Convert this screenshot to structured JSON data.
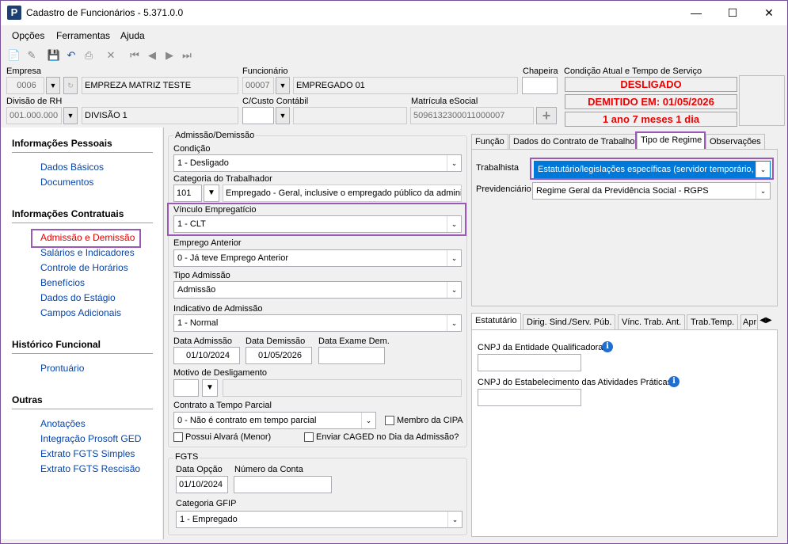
{
  "window": {
    "title": "Cadastro de Funcionários - 5.371.0.0",
    "app_icon": "P"
  },
  "menu": [
    "Opções",
    "Ferramentas",
    "Ajuda"
  ],
  "header": {
    "empresa_label": "Empresa",
    "empresa_code": "0006",
    "empresa_name": "EMPREZA MATRIZ TESTE",
    "funcionario_label": "Funcionário",
    "funcionario_code": "00007",
    "funcionario_name": "EMPREGADO 01",
    "chapeira_label": "Chapeira",
    "chapeira_value": "",
    "divisao_label": "Divisão de RH",
    "divisao_code": "001.000.000",
    "divisao_name": "DIVISÃO 1",
    "ccusto_label": "C/Custo Contábil",
    "matricula_label": "Matrícula eSocial",
    "matricula_value": "5096132300011000007",
    "status_label": "Condição Atual e Tempo de Serviço",
    "status_1": "DESLIGADO",
    "status_2": "DEMITIDO EM: 01/05/2026",
    "status_3": "1 ano 7 meses 1 dia"
  },
  "sidebar": {
    "sections": [
      {
        "title": "Informações Pessoais",
        "items": [
          "Dados Básicos",
          "Documentos"
        ]
      },
      {
        "title": "Informações Contratuais",
        "items": [
          "Admissão e Demissão",
          "Salários e Indicadores",
          "Controle de Horários",
          "Benefícios",
          "Dados do Estágio",
          "Campos Adicionais"
        ]
      },
      {
        "title": "Histórico Funcional",
        "items": [
          "Prontuário"
        ]
      },
      {
        "title": "Outras",
        "items": [
          "Anotações",
          "Integração Prosoft GED",
          "Extrato FGTS Simples",
          "Extrato FGTS Rescisão"
        ]
      }
    ]
  },
  "admissao": {
    "group_title": "Admissão/Demissão",
    "condicao_label": "Condição",
    "condicao_value": "1 - Desligado",
    "categoria_label": "Categoria do Trabalhador",
    "categoria_code": "101",
    "categoria_desc": "Empregado - Geral, inclusive o empregado público da administ",
    "vinculo_label": "Vínculo Empregatício",
    "vinculo_value": "1 - CLT",
    "emprego_ant_label": "Emprego Anterior",
    "emprego_ant_value": "0 - Já teve Emprego Anterior",
    "tipo_adm_label": "Tipo Admissão",
    "tipo_adm_value": "Admissão",
    "indicativo_label": "Indicativo de Admissão",
    "indicativo_value": "1 - Normal",
    "data_adm_label": "Data Admissão",
    "data_adm_value": "01/10/2024",
    "data_dem_label": "Data Demissão",
    "data_dem_value": "01/05/2026",
    "data_exame_label": "Data Exame Dem.",
    "data_exame_value": "",
    "motivo_label": "Motivo de Desligamento",
    "contrato_label": "Contrato a Tempo Parcial",
    "contrato_value": "0 - Não é contrato em tempo parcial",
    "cipa_label": "Membro da CIPA",
    "alvara_label": "Possui Alvará (Menor)",
    "caged_label": "Enviar CAGED no Dia da Admissão?"
  },
  "fgts": {
    "group_title": "FGTS",
    "data_opcao_label": "Data Opção",
    "data_opcao_value": "01/10/2024",
    "conta_label": "Número da Conta",
    "conta_value": "",
    "gfip_label": "Categoria GFIP",
    "gfip_value": "1 - Empregado"
  },
  "right_tabs": [
    "Função",
    "Dados do Contrato de Trabalho",
    "Tipo de Regime",
    "Observações"
  ],
  "regime": {
    "trabalhista_label": "Trabalhista",
    "trabalhista_value": "Estatutário/legislações específicas (servidor temporário, m",
    "previdenciario_label": "Previdenciário",
    "previdenciario_value": "Regime Geral da Previdência Social - RGPS"
  },
  "lower_tabs": [
    "Estatutário",
    "Dirig. Sind./Serv. Púb.",
    "Vínc. Trab. Ant.",
    "Trab.Temp.",
    "Apr"
  ],
  "estatutario": {
    "cnpj_ent_label": "CNPJ da Entidade Qualificadora",
    "cnpj_est_label": "CNPJ do Estabelecimento das Atividades Práticas"
  },
  "colors": {
    "accent_highlight": "#9b59b6",
    "status_red": "#e00000",
    "link_blue": "#0645ad",
    "active_red": "#e00000"
  }
}
